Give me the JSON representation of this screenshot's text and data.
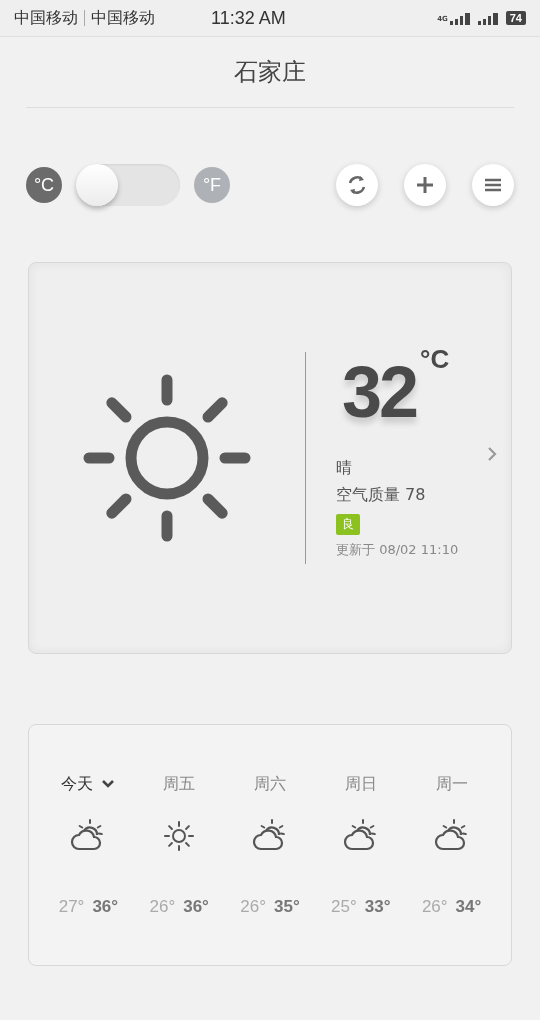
{
  "status_bar": {
    "carriers": [
      "中国移动",
      "中国移动"
    ],
    "time": "11:32 AM",
    "network": "4G",
    "battery": "74"
  },
  "city": "石家庄",
  "units": [
    {
      "label": "°C",
      "selected": true
    },
    {
      "label": "°F",
      "selected": false
    }
  ],
  "unit_toggle": {
    "on": false
  },
  "current": {
    "temperature": "32",
    "unit": "°C",
    "kind": "sunny",
    "condition": "晴",
    "air_quality": "空气质量 78",
    "aqi_badge": {
      "label": "良",
      "color": "#8cc21f"
    },
    "updated": "更新于 08/02 11:10"
  },
  "forecast": [
    {
      "day": "今天",
      "selected": true,
      "kind": "partly-cloudy",
      "low": "27°",
      "high": "36°"
    },
    {
      "day": "周五",
      "selected": false,
      "kind": "sunny",
      "low": "26°",
      "high": "36°"
    },
    {
      "day": "周六",
      "selected": false,
      "kind": "partly-cloudy",
      "low": "26°",
      "high": "35°"
    },
    {
      "day": "周日",
      "selected": false,
      "kind": "partly-cloudy",
      "low": "25°",
      "high": "33°"
    },
    {
      "day": "周一",
      "selected": false,
      "kind": "partly-cloudy",
      "low": "26°",
      "high": "34°"
    }
  ]
}
